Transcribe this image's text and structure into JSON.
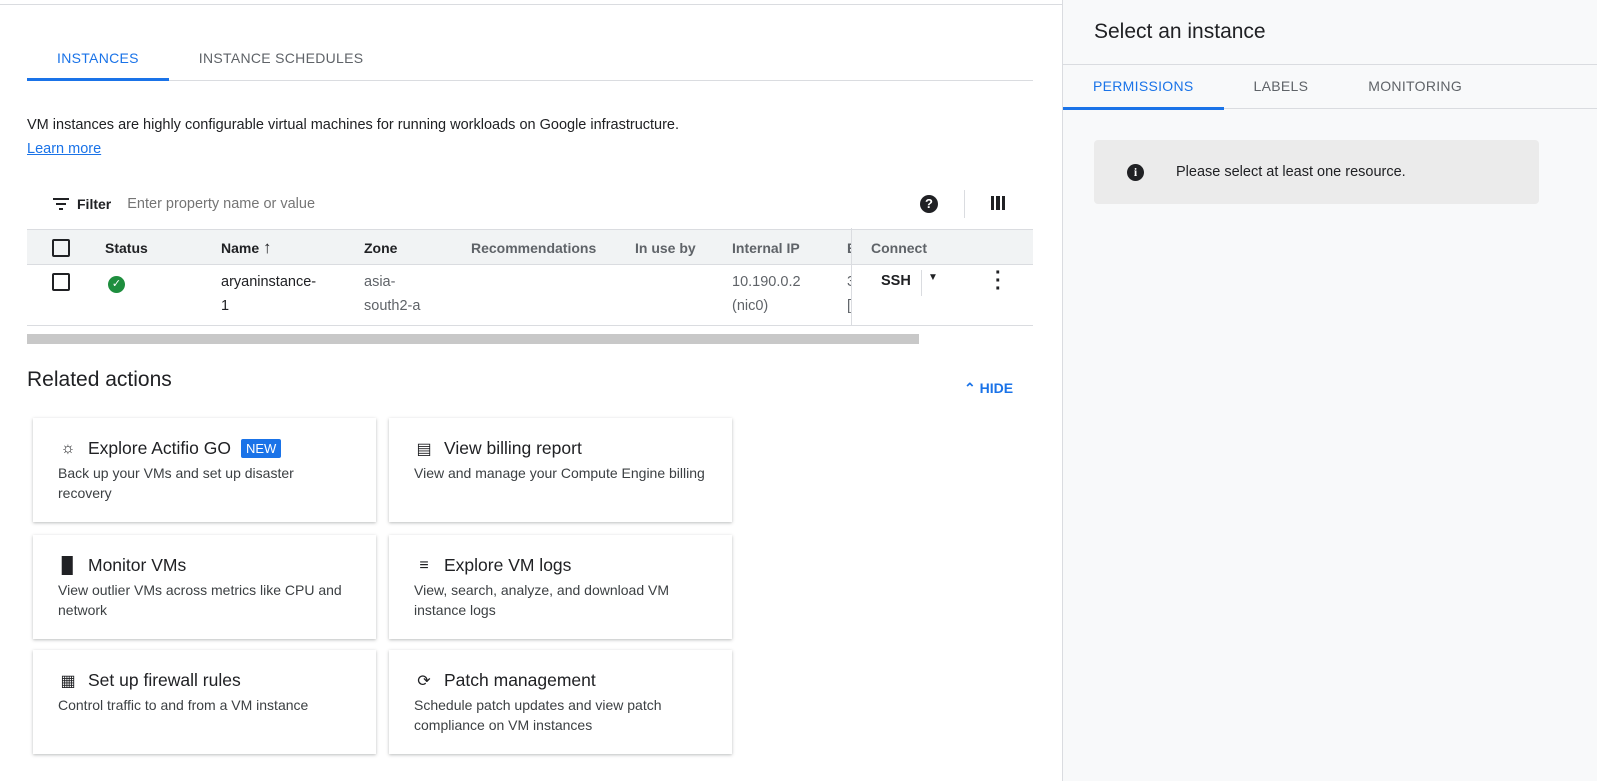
{
  "tabs": [
    {
      "label": "INSTANCES"
    },
    {
      "label": "INSTANCE SCHEDULES"
    }
  ],
  "description": {
    "text": "VM instances are highly configurable virtual machines for running workloads on Google infrastructure.",
    "link": "Learn more"
  },
  "filter": {
    "label": "Filter",
    "placeholder": "Enter property name or value",
    "icon": "filter-icon"
  },
  "table": {
    "columns": [
      "Status",
      "Name",
      "Zone",
      "Recommendations",
      "In use by",
      "Internal IP",
      "E",
      "Connect"
    ],
    "sort_icon": "arrow-up-icon",
    "rows": [
      {
        "status": "running",
        "name": "aryaninstance-\n1",
        "zone_l1": "asia-",
        "zone_l2": "south2-a",
        "ip_l1": "10.190.0.2",
        "ip_l2": "(nic0)",
        "ext_l1": "3",
        "ext_l2": "[",
        "connect": "SSH"
      }
    ]
  },
  "related": {
    "title": "Related actions",
    "hide_label": "HIDE",
    "new_badge": "NEW",
    "cards": [
      {
        "title": "Explore Actifio GO",
        "desc": "Back up your VMs and set up disaster recovery",
        "icon": "backup-icon"
      },
      {
        "title": "View billing report",
        "desc": "View and manage your Compute Engine billing",
        "icon": "credit-card-icon"
      },
      {
        "title": "Monitor VMs",
        "desc": "View outlier VMs across metrics like CPU and network",
        "icon": "bar-chart-icon"
      },
      {
        "title": "Explore VM logs",
        "desc": "View, search, analyze, and download VM instance logs",
        "icon": "logs-icon"
      },
      {
        "title": "Set up firewall rules",
        "desc": "Control traffic to and from a VM instance",
        "icon": "firewall-icon"
      },
      {
        "title": "Patch management",
        "desc": "Schedule patch updates and view patch compliance on VM instances",
        "icon": "patch-icon"
      }
    ]
  },
  "side": {
    "title": "Select an instance",
    "tabs": [
      "PERMISSIONS",
      "LABELS",
      "MONITORING"
    ],
    "info": "Please select at least one resource."
  },
  "colors": {
    "accent": "#1a73e8",
    "status_ok": "#1e8e3e"
  }
}
